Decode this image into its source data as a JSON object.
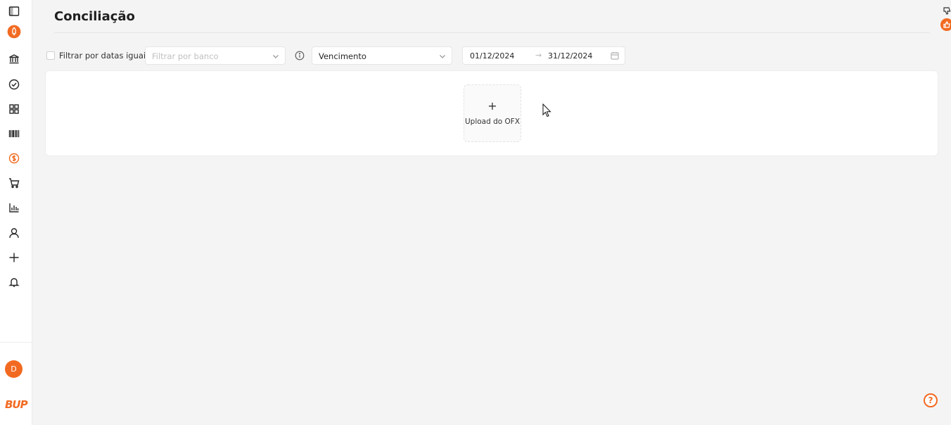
{
  "sidebar": {
    "icons": [
      {
        "name": "sidebar-toggle-icon"
      },
      {
        "name": "rocket-icon",
        "color": "#f26a21"
      },
      {
        "name": "bank-icon"
      },
      {
        "name": "check-circle-icon"
      },
      {
        "name": "grid-icon"
      },
      {
        "name": "barcode-icon"
      },
      {
        "name": "dollar-circle-icon",
        "color": "#f26a21",
        "active": true
      },
      {
        "name": "cart-icon"
      },
      {
        "name": "bar-chart-icon"
      },
      {
        "name": "user-icon"
      },
      {
        "name": "plus-icon"
      },
      {
        "name": "bell-icon"
      }
    ],
    "avatar_initial": "D",
    "brand": "BUP"
  },
  "page": {
    "title": "Conciliação"
  },
  "filters": {
    "same_dates_label": "Filtrar por datas iguais",
    "same_dates_checked": false,
    "bank_placeholder": "Filtrar por banco",
    "date_type_value": "Vencimento",
    "date_start": "01/12/2024",
    "date_separator": "→",
    "date_end": "31/12/2024"
  },
  "upload": {
    "icon": "+",
    "label": "Upload do OFX"
  },
  "help": {
    "icon": "?"
  },
  "colors": {
    "accent": "#f26a21",
    "background": "#f4f4f4"
  }
}
